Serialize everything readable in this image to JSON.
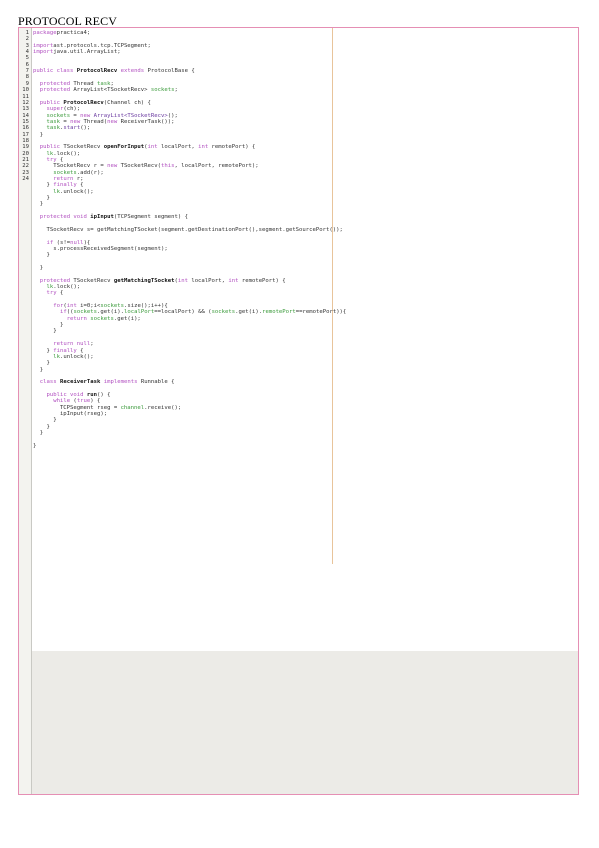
{
  "document": {
    "title": "PROTOCOL RECV"
  },
  "gutter_numbers": [
    "1",
    "2",
    "3",
    "4",
    "5",
    "6",
    "7",
    "8",
    "9",
    "10",
    "11",
    "12",
    "13",
    "14",
    "15",
    "16",
    "17",
    "18",
    "19",
    "20",
    "21",
    "22",
    "23",
    "24"
  ],
  "code_lines": [
    [
      [
        "kw",
        "package"
      ],
      [
        "",
        "practica4;"
      ]
    ],
    [],
    [
      [
        "kw",
        "import"
      ],
      [
        "",
        "ast.protocols.tcp.TCPSegment;"
      ]
    ],
    [
      [
        "kw",
        "import"
      ],
      [
        "",
        "java.util.ArrayList;"
      ]
    ],
    [],
    [],
    [
      [
        "kw",
        "public class"
      ],
      [
        "",
        " "
      ],
      [
        "bd",
        "ProtocolRecv"
      ],
      [
        "",
        " "
      ],
      [
        "kw",
        "extends"
      ],
      [
        "",
        " ProtocolBase {"
      ]
    ],
    [],
    [
      [
        "",
        "  "
      ],
      [
        "kw",
        "protected"
      ],
      [
        "",
        " Thread "
      ],
      [
        "gr",
        "task"
      ],
      [
        "",
        ";"
      ]
    ],
    [
      [
        "",
        "  "
      ],
      [
        "kw",
        "protected"
      ],
      [
        "",
        " ArrayList<TSocketRecv> "
      ],
      [
        "gr",
        "sockets"
      ],
      [
        "",
        ";"
      ]
    ],
    [],
    [
      [
        "",
        "  "
      ],
      [
        "kw",
        "public"
      ],
      [
        "",
        " "
      ],
      [
        "bd",
        "ProtocolRecv"
      ],
      [
        "",
        "(Channel ch) {"
      ]
    ],
    [
      [
        "",
        "    "
      ],
      [
        "kw",
        "super"
      ],
      [
        "",
        "(ch);"
      ]
    ],
    [
      [
        "",
        "    "
      ],
      [
        "gr",
        "sockets"
      ],
      [
        "",
        " = "
      ],
      [
        "kw",
        "new"
      ],
      [
        "",
        " "
      ],
      [
        "st",
        "ArrayList<TSocketRecv>"
      ],
      [
        "",
        "();"
      ]
    ],
    [
      [
        "",
        "    "
      ],
      [
        "gr",
        "task"
      ],
      [
        "",
        " = "
      ],
      [
        "kw",
        "new"
      ],
      [
        "",
        " Thread("
      ],
      [
        "kw",
        "new"
      ],
      [
        "",
        " ReceiverTask());"
      ]
    ],
    [
      [
        "",
        "    "
      ],
      [
        "gr",
        "task"
      ],
      [
        "",
        "."
      ],
      [
        "st",
        "start"
      ],
      [
        "",
        "();"
      ]
    ],
    [
      [
        "",
        "  }"
      ]
    ],
    [],
    [
      [
        "",
        "  "
      ],
      [
        "kw",
        "public"
      ],
      [
        "",
        " TSocketRecv "
      ],
      [
        "bd",
        "openForInput"
      ],
      [
        "",
        "("
      ],
      [
        "kw",
        "int"
      ],
      [
        "",
        " localPort, "
      ],
      [
        "kw",
        "int"
      ],
      [
        "",
        " remotePort) {"
      ]
    ],
    [
      [
        "",
        "    "
      ],
      [
        "gr",
        "lk"
      ],
      [
        "",
        ".lock();"
      ]
    ],
    [
      [
        "",
        "    "
      ],
      [
        "kw",
        "try"
      ],
      [
        "",
        " {"
      ]
    ],
    [
      [
        "",
        "      TSocketRecv r = "
      ],
      [
        "kw",
        "new"
      ],
      [
        "",
        " TSocketRecv("
      ],
      [
        "kw",
        "this"
      ],
      [
        "",
        ", localPort, remotePort);"
      ]
    ],
    [
      [
        "",
        "      "
      ],
      [
        "gr",
        "sockets"
      ],
      [
        "",
        ".add(r);"
      ]
    ],
    [
      [
        "",
        "      "
      ],
      [
        "kw",
        "return"
      ],
      [
        "",
        " r;"
      ]
    ],
    [
      [
        "",
        "    } "
      ],
      [
        "kw",
        "finally"
      ],
      [
        "",
        " {"
      ]
    ],
    [
      [
        "",
        "      "
      ],
      [
        "gr",
        "lk"
      ],
      [
        "",
        ".unlock();"
      ]
    ],
    [
      [
        "",
        "    }"
      ]
    ],
    [
      [
        "",
        "  }"
      ]
    ],
    [],
    [
      [
        "",
        "  "
      ],
      [
        "kw",
        "protected void"
      ],
      [
        "",
        " "
      ],
      [
        "bd",
        "ipInput"
      ],
      [
        "",
        "(TCPSegment segment) {"
      ]
    ],
    [],
    [
      [
        "",
        "    TSocketRecv s= getMatchingTSocket(segment.getDestinationPort(),segment.getSourcePort());"
      ]
    ],
    [],
    [
      [
        "",
        "    "
      ],
      [
        "kw",
        "if"
      ],
      [
        "",
        " (s!="
      ],
      [
        "kw",
        "null"
      ],
      [
        "",
        "){"
      ]
    ],
    [
      [
        "",
        "      s.processReceivedSegment(segment);"
      ]
    ],
    [
      [
        "",
        "    }"
      ]
    ],
    [],
    [
      [
        "",
        "  }"
      ]
    ],
    [],
    [
      [
        "",
        "  "
      ],
      [
        "kw",
        "protected"
      ],
      [
        "",
        " TSocketRecv "
      ],
      [
        "bd",
        "getMatchingTSocket"
      ],
      [
        "",
        "("
      ],
      [
        "kw",
        "int"
      ],
      [
        "",
        " localPort, "
      ],
      [
        "kw",
        "int"
      ],
      [
        "",
        " remotePort) {"
      ]
    ],
    [
      [
        "",
        "    "
      ],
      [
        "gr",
        "lk"
      ],
      [
        "",
        ".lock();"
      ]
    ],
    [
      [
        "",
        "    "
      ],
      [
        "kw",
        "try"
      ],
      [
        "",
        " {"
      ]
    ],
    [],
    [
      [
        "",
        "      "
      ],
      [
        "kw",
        "for"
      ],
      [
        "",
        "("
      ],
      [
        "kw",
        "int"
      ],
      [
        "",
        " i=0;i<"
      ],
      [
        "gr",
        "sockets"
      ],
      [
        "",
        ".size();i++){"
      ]
    ],
    [
      [
        "",
        "        "
      ],
      [
        "kw",
        "if"
      ],
      [
        "",
        "(("
      ],
      [
        "gr",
        "sockets"
      ],
      [
        "",
        ".get(i)."
      ],
      [
        "gr",
        "localPort"
      ],
      [
        "",
        "==localPort) && ("
      ],
      [
        "gr",
        "sockets"
      ],
      [
        "",
        ".get(i)."
      ],
      [
        "gr",
        "remotePort"
      ],
      [
        "",
        "==remotePort)){"
      ]
    ],
    [
      [
        "",
        "          "
      ],
      [
        "kw",
        "return"
      ],
      [
        "",
        " "
      ],
      [
        "gr",
        "sockets"
      ],
      [
        "",
        ".get(i);"
      ]
    ],
    [
      [
        "",
        "        }"
      ]
    ],
    [
      [
        "",
        "      }"
      ]
    ],
    [],
    [
      [
        "",
        "      "
      ],
      [
        "kw",
        "return null"
      ],
      [
        "",
        ";"
      ]
    ],
    [
      [
        "",
        "    } "
      ],
      [
        "kw",
        "finally"
      ],
      [
        "",
        " {"
      ]
    ],
    [
      [
        "",
        "      "
      ],
      [
        "gr",
        "lk"
      ],
      [
        "",
        ".unlock();"
      ]
    ],
    [
      [
        "",
        "    }"
      ]
    ],
    [
      [
        "",
        "  }"
      ]
    ],
    [],
    [
      [
        "",
        "  "
      ],
      [
        "kw",
        "class"
      ],
      [
        "",
        " "
      ],
      [
        "bd",
        "ReceiverTask"
      ],
      [
        "",
        " "
      ],
      [
        "kw",
        "implements"
      ],
      [
        "",
        " Runnable {"
      ]
    ],
    [],
    [
      [
        "",
        "    "
      ],
      [
        "kw",
        "public void"
      ],
      [
        "",
        " "
      ],
      [
        "bd",
        "run"
      ],
      [
        "",
        "() {"
      ]
    ],
    [
      [
        "",
        "      "
      ],
      [
        "kw",
        "while"
      ],
      [
        "",
        " ("
      ],
      [
        "kw",
        "true"
      ],
      [
        "",
        ") {"
      ]
    ],
    [
      [
        "",
        "        TCPSegment rseg = "
      ],
      [
        "gr",
        "channel"
      ],
      [
        "",
        ".receive();"
      ]
    ],
    [
      [
        "",
        "        ipInput(rseg);"
      ]
    ],
    [
      [
        "",
        "      }"
      ]
    ],
    [
      [
        "",
        "    }"
      ]
    ],
    [
      [
        "",
        "  }"
      ]
    ],
    [],
    [
      [
        "",
        "}"
      ]
    ]
  ]
}
